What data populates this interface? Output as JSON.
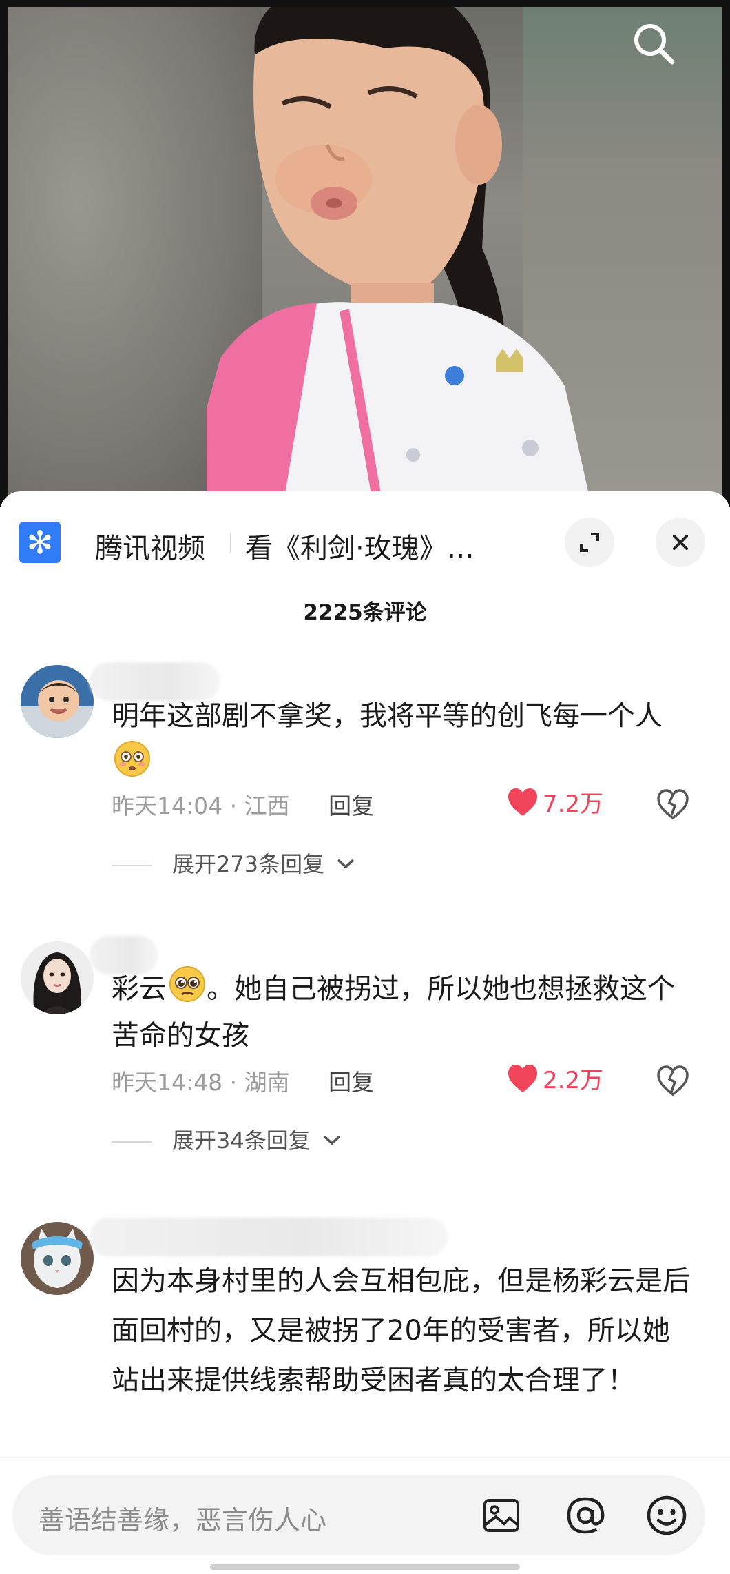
{
  "source_bar": {
    "app_name": "腾讯视频",
    "video_title": "看《利剑·玫瑰》…"
  },
  "comments_header": "2225条评论",
  "comments": [
    {
      "text": "明年这部剧不拿奖，我将平等的创飞每一个人",
      "emoji": "flushed-face-emoji",
      "time": "昨天14:04",
      "location": "江西",
      "reply_label": "回复",
      "likes": "7.2万",
      "expand_label": "展开273条回复"
    },
    {
      "text_before_emoji": "彩云",
      "emoji": "pleading-face-emoji",
      "text_after_emoji": "。她自己被拐过，所以她也想拯救这个苦命的女孩",
      "time": "昨天14:48",
      "location": "湖南",
      "reply_label": "回复",
      "likes": "2.2万",
      "expand_label": "展开34条回复"
    },
    {
      "text": "因为本身村里的人会互相包庇，但是杨彩云是后面回村的，又是被拐了20年的受害者，所以她站出来提供线索帮助受困者真的太合理了！"
    }
  ],
  "input": {
    "placeholder": "善语结善缘，恶言伤人心"
  },
  "colors": {
    "like": "#f0445a",
    "logo": "#2f7cf6",
    "meta": "#9b9b9b"
  },
  "icons": [
    "search-icon",
    "expand-icon",
    "close-icon",
    "heart-icon",
    "dislike-icon",
    "chevron-down-icon",
    "image-icon",
    "at-icon",
    "smiley-icon"
  ]
}
